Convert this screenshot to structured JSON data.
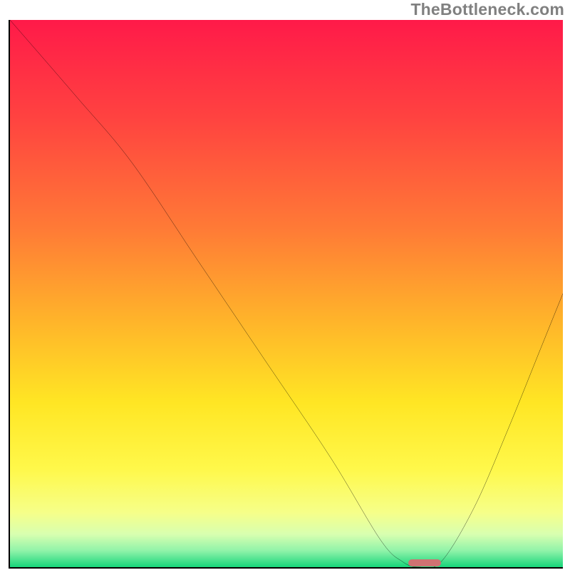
{
  "watermark": "TheBottleneck.com",
  "chart_data": {
    "type": "line",
    "title": "",
    "xlabel": "",
    "ylabel": "",
    "xlim": [
      0,
      100
    ],
    "ylim": [
      0,
      100
    ],
    "gradient_meaning": "vertical color scale: top=red (high bottleneck), bottom=green (low bottleneck)",
    "series": [
      {
        "name": "bottleneck-curve",
        "x": [
          0,
          12,
          22,
          34,
          46,
          58,
          67,
          71,
          74,
          78,
          84,
          90,
          96,
          100
        ],
        "values": [
          100,
          86,
          74,
          56,
          38,
          20,
          5,
          1,
          0,
          1,
          11,
          25,
          40,
          50
        ]
      }
    ],
    "optimal_range_x": [
      72,
      78
    ],
    "marker_color": "#cf7272"
  }
}
